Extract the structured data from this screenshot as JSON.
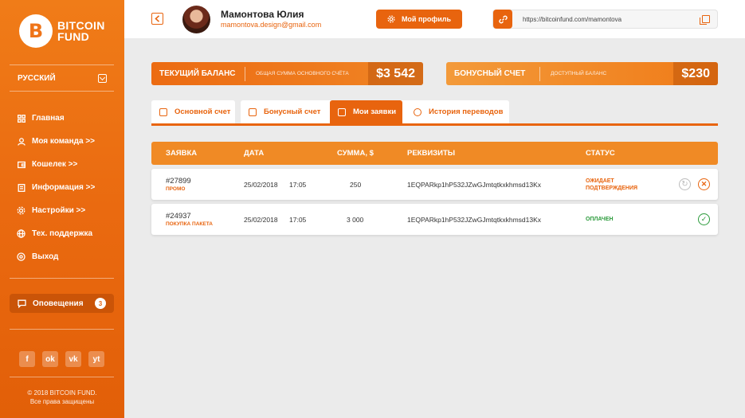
{
  "brand": {
    "logo_letter": "B",
    "line1": "BITCOIN",
    "line2": "FUND"
  },
  "sidebar": {
    "language": "РУССКИЙ",
    "items": [
      {
        "label": "Главная",
        "icon": "grid-icon"
      },
      {
        "label": "Моя команда >>",
        "icon": "user-icon"
      },
      {
        "label": "Кошелек >>",
        "icon": "wallet-icon"
      },
      {
        "label": "Информация >>",
        "icon": "document-icon"
      },
      {
        "label": "Настройки >>",
        "icon": "gear-icon"
      },
      {
        "label": "Тех. поддержка",
        "icon": "globe-icon"
      },
      {
        "label": "Выход",
        "icon": "power-icon"
      }
    ],
    "notifications": {
      "label": "Оповещения",
      "count": "3"
    },
    "socials": [
      "f",
      "ok",
      "vk",
      "yt"
    ],
    "copyright_line1": "© 2018 BITCOIN FUND.",
    "copyright_line2": "Все права защищены"
  },
  "header": {
    "user_name": "Мамонтова Юлия",
    "user_email": "mamontova.design@gmail.com",
    "profile_button": "Мой профиль",
    "referral_url": "https://bitcoinfund.com/mamontova"
  },
  "balances": {
    "main": {
      "title": "ТЕКУЩИЙ БАЛАНС",
      "subtitle": "ОБЩАЯ СУММА ОСНОВНОГО СЧЁТА",
      "value": "$3 542"
    },
    "bonus": {
      "title": "БОНУСНЫЙ СЧЕТ",
      "subtitle": "ДОСТУПНЫЙ БАЛАНС",
      "value": "$230"
    }
  },
  "tabs": [
    "Основной счет",
    "Бонусный счет",
    "Мои заявки",
    "История переводов"
  ],
  "table": {
    "headers": [
      "ЗАЯВКА",
      "ДАТА",
      "СУММА, $",
      "РЕКВИЗИТЫ",
      "СТАТУС"
    ],
    "rows": [
      {
        "id": "#27899",
        "type": "ПРОМО",
        "date": "25/02/2018",
        "time": "17:05",
        "amount": "250",
        "requisites": "1EQPARkp1hP532JZwGJmtqtkxkhmsd13Kx",
        "status_line1": "ОЖИДАЕТ",
        "status_line2": "ПОДТВЕРЖДЕНИЯ"
      },
      {
        "id": "#24937",
        "type": "ПОКУПКА ПАКЕТА",
        "date": "25/02/2018",
        "time": "17:05",
        "amount": "3 000",
        "requisites": "1EQPARkp1hP532JZwGJmtqtkxkhmsd13Kx",
        "status_line1": "ОПЛАЧЕН",
        "status_line2": ""
      }
    ]
  },
  "colors": {
    "accent": "#e8640e",
    "paid": "#2a9a3a"
  }
}
